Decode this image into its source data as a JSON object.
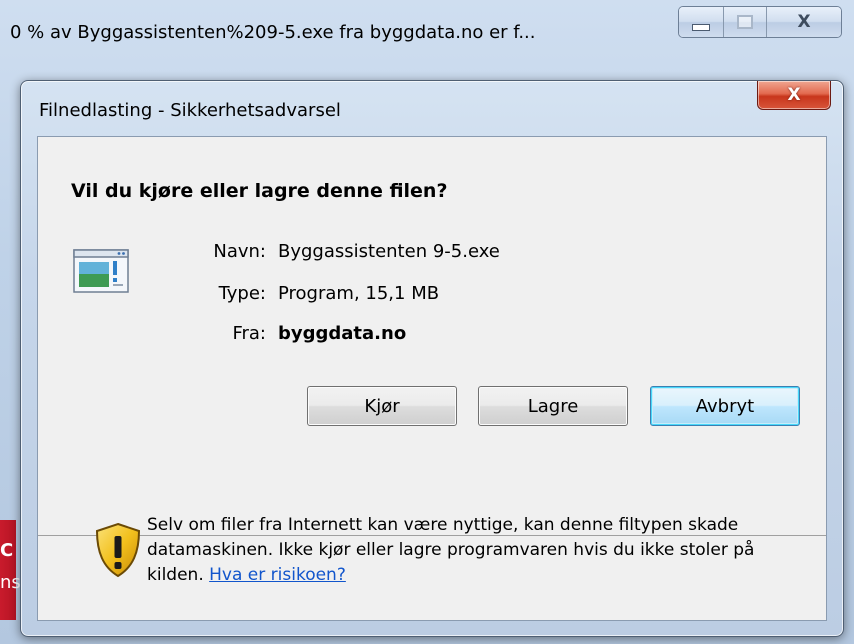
{
  "background_window": {
    "title": "0 % av Byggassistenten%209-5.exe fra byggdata.no er f...",
    "close_label": "X",
    "sliver_text_top": "C",
    "sliver_text_bottom": "ns"
  },
  "dialog": {
    "title": "Filnedlasting - Sikkerhetsadvarsel",
    "close_label": "X",
    "question": "Vil du kjøre eller lagre denne filen?",
    "file_info": {
      "name_label": "Navn:",
      "name_value": "Byggassistenten 9-5.exe",
      "type_label": "Type:",
      "type_value": "Program, 15,1 MB",
      "from_label": "Fra:",
      "from_value": "byggdata.no"
    },
    "buttons": {
      "run": "Kjør",
      "save": "Lagre",
      "cancel": "Avbryt"
    },
    "warning": {
      "text": "Selv om filer fra Internett kan være nyttige, kan denne filtypen skade datamaskinen. Ikke kjør eller lagre programvaren hvis du ikke stoler på kilden.",
      "link": "Hva er risikoen?"
    },
    "icons": {
      "file": "program-file-icon",
      "warning": "warning-shield-icon"
    },
    "colors": {
      "link": "#1155cc",
      "default_button_border": "#3c7fb1",
      "close_button": "#c8361c",
      "shield_yellow": "#f2c01d"
    }
  }
}
